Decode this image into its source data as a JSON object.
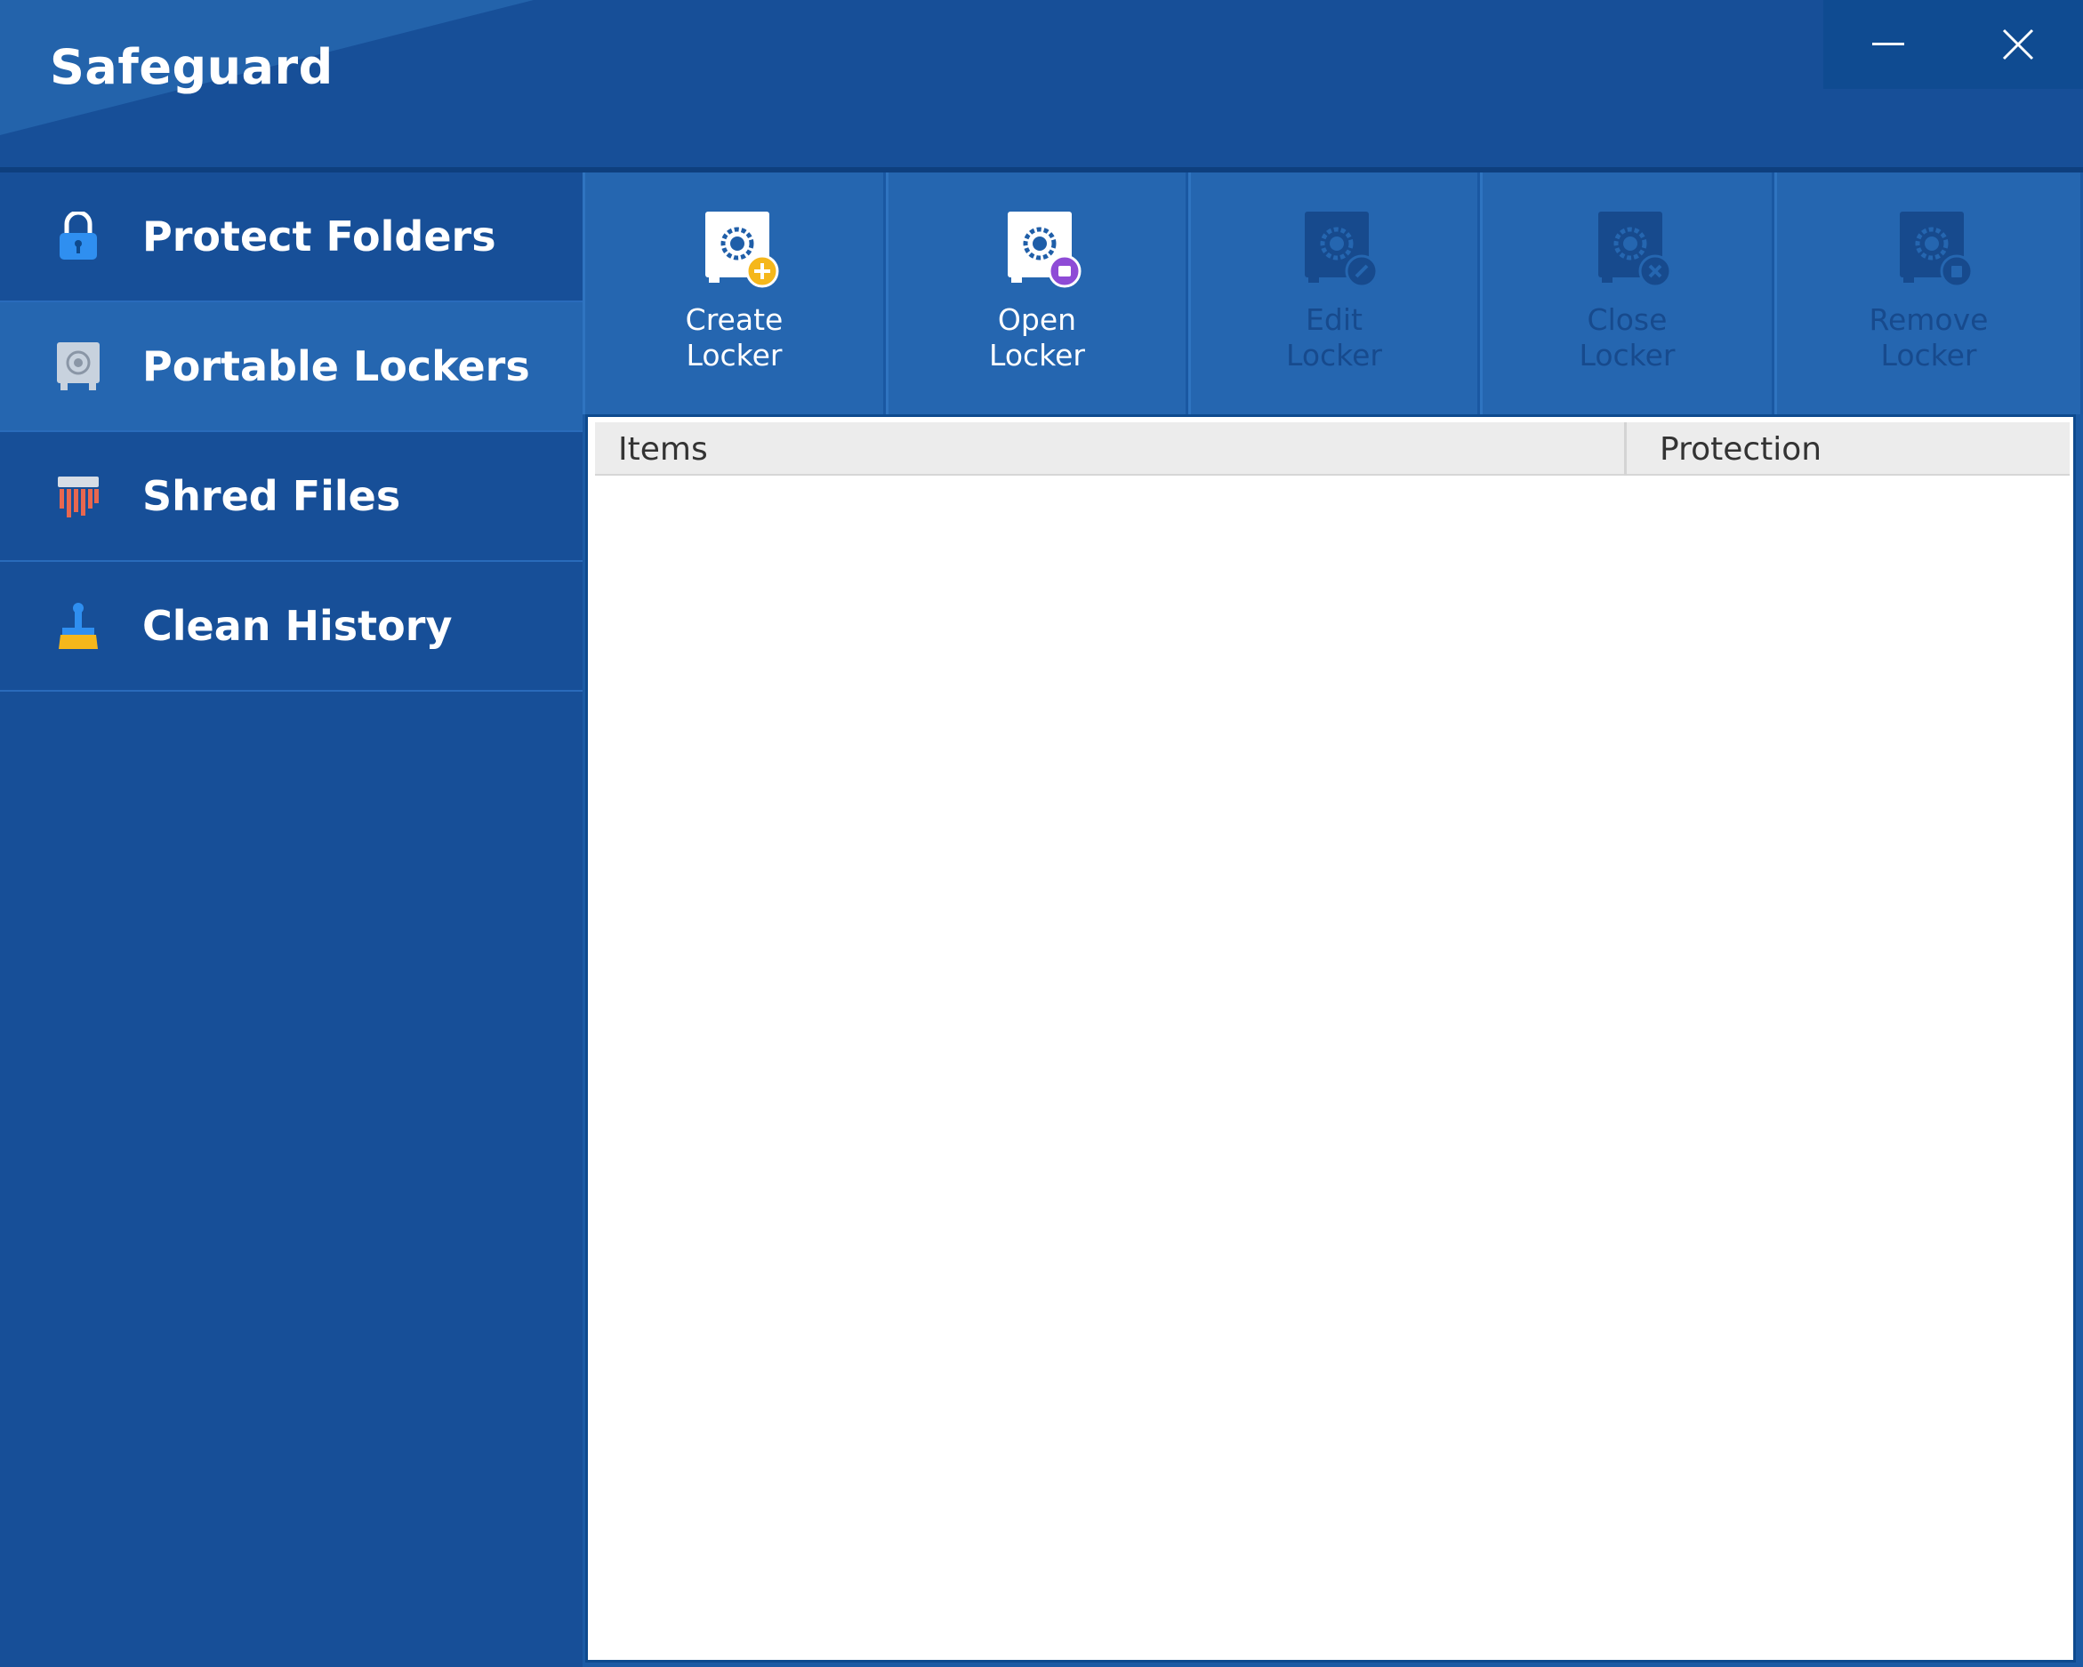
{
  "window": {
    "title": "Safeguard",
    "controls": {
      "minimize_icon": "minimize-icon",
      "close_icon": "close-icon"
    }
  },
  "sidebar": {
    "items": [
      {
        "label": "Protect Folders",
        "icon": "padlock-icon",
        "active": false
      },
      {
        "label": "Portable Lockers",
        "icon": "safe-icon",
        "active": true
      },
      {
        "label": "Shred Files",
        "icon": "shredder-icon",
        "active": false
      },
      {
        "label": "Clean History",
        "icon": "broom-icon",
        "active": false
      }
    ]
  },
  "toolbar": {
    "buttons": [
      {
        "label": "Create\nLocker",
        "icon": "create-locker-icon",
        "enabled": true,
        "badge_color": "#f5b71b"
      },
      {
        "label": "Open\nLocker",
        "icon": "open-locker-icon",
        "enabled": true,
        "badge_color": "#8e4bd6"
      },
      {
        "label": "Edit\nLocker",
        "icon": "edit-locker-icon",
        "enabled": false
      },
      {
        "label": "Close\nLocker",
        "icon": "close-locker-icon",
        "enabled": false
      },
      {
        "label": "Remove\nLocker",
        "icon": "remove-locker-icon",
        "enabled": false
      }
    ]
  },
  "list": {
    "columns": [
      "Items",
      "Protection"
    ],
    "rows": []
  },
  "colors": {
    "background": "#174f98",
    "active_nav": "#2566b0",
    "toolbar": "#2566b0"
  }
}
